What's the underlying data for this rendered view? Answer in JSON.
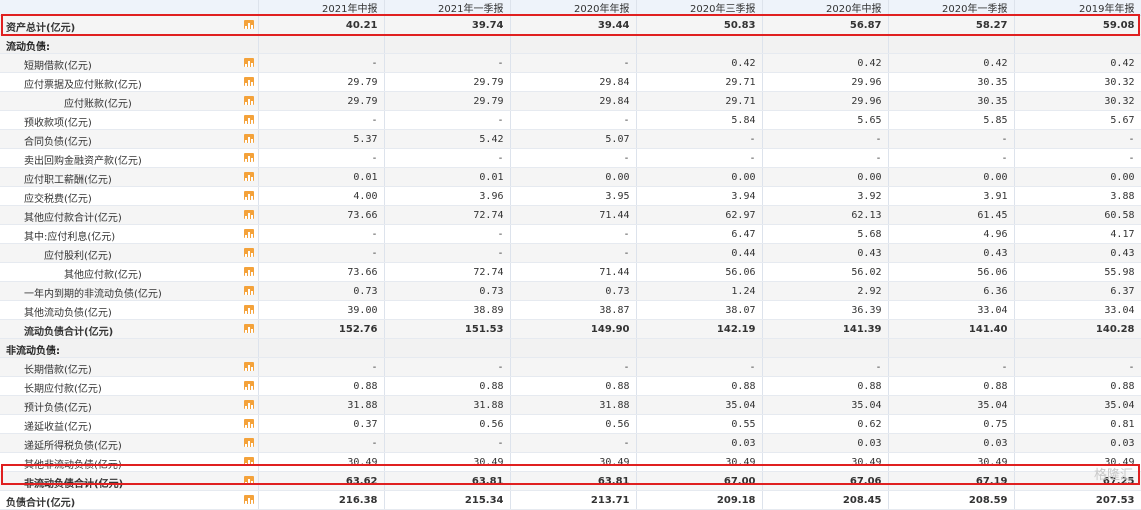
{
  "columns": [
    "2021年中报",
    "2021年一季报",
    "2020年年报",
    "2020年三季报",
    "2020年中报",
    "2020年一季报",
    "2019年年报"
  ],
  "rows": [
    {
      "label": "资产总计(亿元)",
      "indent": 0,
      "bold": true,
      "icon": true,
      "values": [
        "40.21",
        "39.74",
        "39.44",
        "50.83",
        "56.87",
        "58.27",
        "59.08"
      ]
    },
    {
      "label": "流动负债:",
      "section": true
    },
    {
      "label": "短期借款(亿元)",
      "indent": 1,
      "icon": true,
      "values": [
        "-",
        "-",
        "-",
        "0.42",
        "0.42",
        "0.42",
        "0.42"
      ]
    },
    {
      "label": "应付票据及应付账款(亿元)",
      "indent": 1,
      "icon": true,
      "values": [
        "29.79",
        "29.79",
        "29.84",
        "29.71",
        "29.96",
        "30.35",
        "30.32"
      ]
    },
    {
      "label": "应付账款(亿元)",
      "indent": 3,
      "icon": true,
      "values": [
        "29.79",
        "29.79",
        "29.84",
        "29.71",
        "29.96",
        "30.35",
        "30.32"
      ]
    },
    {
      "label": "预收款项(亿元)",
      "indent": 1,
      "icon": true,
      "values": [
        "-",
        "-",
        "-",
        "5.84",
        "5.65",
        "5.85",
        "5.67"
      ]
    },
    {
      "label": "合同负债(亿元)",
      "indent": 1,
      "icon": true,
      "values": [
        "5.37",
        "5.42",
        "5.07",
        "-",
        "-",
        "-",
        "-"
      ]
    },
    {
      "label": "卖出回购金融资产款(亿元)",
      "indent": 1,
      "icon": true,
      "values": [
        "-",
        "-",
        "-",
        "-",
        "-",
        "-",
        "-"
      ]
    },
    {
      "label": "应付职工薪酬(亿元)",
      "indent": 1,
      "icon": true,
      "values": [
        "0.01",
        "0.01",
        "0.00",
        "0.00",
        "0.00",
        "0.00",
        "0.00"
      ]
    },
    {
      "label": "应交税费(亿元)",
      "indent": 1,
      "icon": true,
      "values": [
        "4.00",
        "3.96",
        "3.95",
        "3.94",
        "3.92",
        "3.91",
        "3.88"
      ]
    },
    {
      "label": "其他应付款合计(亿元)",
      "indent": 1,
      "icon": true,
      "values": [
        "73.66",
        "72.74",
        "71.44",
        "62.97",
        "62.13",
        "61.45",
        "60.58"
      ]
    },
    {
      "label": "其中:应付利息(亿元)",
      "indent": 1,
      "icon": true,
      "values": [
        "-",
        "-",
        "-",
        "6.47",
        "5.68",
        "4.96",
        "4.17"
      ]
    },
    {
      "label": "应付股利(亿元)",
      "indent": 2,
      "icon": true,
      "values": [
        "-",
        "-",
        "-",
        "0.44",
        "0.43",
        "0.43",
        "0.43"
      ]
    },
    {
      "label": "其他应付款(亿元)",
      "indent": 3,
      "icon": true,
      "values": [
        "73.66",
        "72.74",
        "71.44",
        "56.06",
        "56.02",
        "56.06",
        "55.98"
      ]
    },
    {
      "label": "一年内到期的非流动负债(亿元)",
      "indent": 1,
      "icon": true,
      "values": [
        "0.73",
        "0.73",
        "0.73",
        "1.24",
        "2.92",
        "6.36",
        "6.37"
      ]
    },
    {
      "label": "其他流动负债(亿元)",
      "indent": 1,
      "icon": true,
      "values": [
        "39.00",
        "38.89",
        "38.87",
        "38.07",
        "36.39",
        "33.04",
        "33.04"
      ]
    },
    {
      "label": "流动负债合计(亿元)",
      "indent": 1,
      "bold": true,
      "icon": true,
      "values": [
        "152.76",
        "151.53",
        "149.90",
        "142.19",
        "141.39",
        "141.40",
        "140.28"
      ]
    },
    {
      "label": "非流动负债:",
      "section": true
    },
    {
      "label": "长期借款(亿元)",
      "indent": 1,
      "icon": true,
      "values": [
        "-",
        "-",
        "-",
        "-",
        "-",
        "-",
        "-"
      ]
    },
    {
      "label": "长期应付款(亿元)",
      "indent": 1,
      "icon": true,
      "values": [
        "0.88",
        "0.88",
        "0.88",
        "0.88",
        "0.88",
        "0.88",
        "0.88"
      ]
    },
    {
      "label": "预计负债(亿元)",
      "indent": 1,
      "icon": true,
      "values": [
        "31.88",
        "31.88",
        "31.88",
        "35.04",
        "35.04",
        "35.04",
        "35.04"
      ]
    },
    {
      "label": "递延收益(亿元)",
      "indent": 1,
      "icon": true,
      "values": [
        "0.37",
        "0.56",
        "0.56",
        "0.55",
        "0.62",
        "0.75",
        "0.81"
      ]
    },
    {
      "label": "递延所得税负债(亿元)",
      "indent": 1,
      "icon": true,
      "values": [
        "-",
        "-",
        "-",
        "0.03",
        "0.03",
        "0.03",
        "0.03"
      ]
    },
    {
      "label": "其他非流动负债(亿元)",
      "indent": 1,
      "icon": true,
      "values": [
        "30.49",
        "30.49",
        "30.49",
        "30.49",
        "30.49",
        "30.49",
        "30.49"
      ]
    },
    {
      "label": "非流动负债合计(亿元)",
      "indent": 1,
      "bold": true,
      "icon": true,
      "values": [
        "63.62",
        "63.81",
        "63.81",
        "67.00",
        "67.06",
        "67.19",
        "67.25"
      ]
    },
    {
      "label": "负债合计(亿元)",
      "indent": 0,
      "bold": true,
      "icon": true,
      "values": [
        "216.38",
        "215.34",
        "213.71",
        "209.18",
        "208.45",
        "208.59",
        "207.53"
      ]
    }
  ],
  "watermark": "格隆汇",
  "colors": {
    "highlight": "#e02020",
    "icon": "#f4a23a",
    "header_bg": "#eef3fa"
  }
}
